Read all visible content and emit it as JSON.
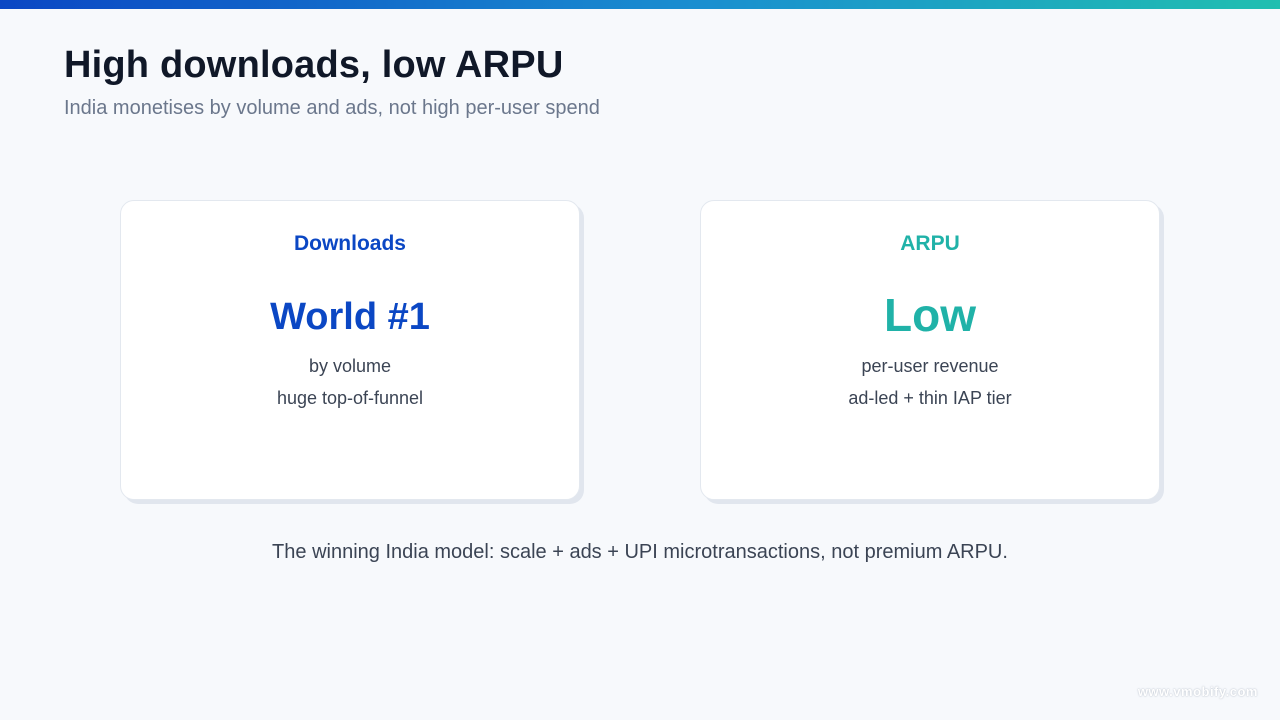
{
  "slide": {
    "title": "High downloads, low ARPU",
    "subtitle": "India monetises by volume and ads, not high per-user spend",
    "footer_note": "The winning India model: scale + ads + UPI microtransactions, not premium ARPU.",
    "watermark": "www.vmobify.com"
  },
  "cards": [
    {
      "label": "Downloads",
      "value": "World #1",
      "line1": "by volume",
      "line2": "huge top-of-funnel",
      "accent": "#0b47c4"
    },
    {
      "label": "ARPU",
      "value": "Low",
      "line1": "per-user revenue",
      "line2": "ad-led + thin IAP tier",
      "accent": "#20b2a8"
    }
  ],
  "colors": {
    "background": "#f7f9fc",
    "title": "#101828",
    "subtitle": "#6b778c",
    "body_text": "#3b4454"
  }
}
